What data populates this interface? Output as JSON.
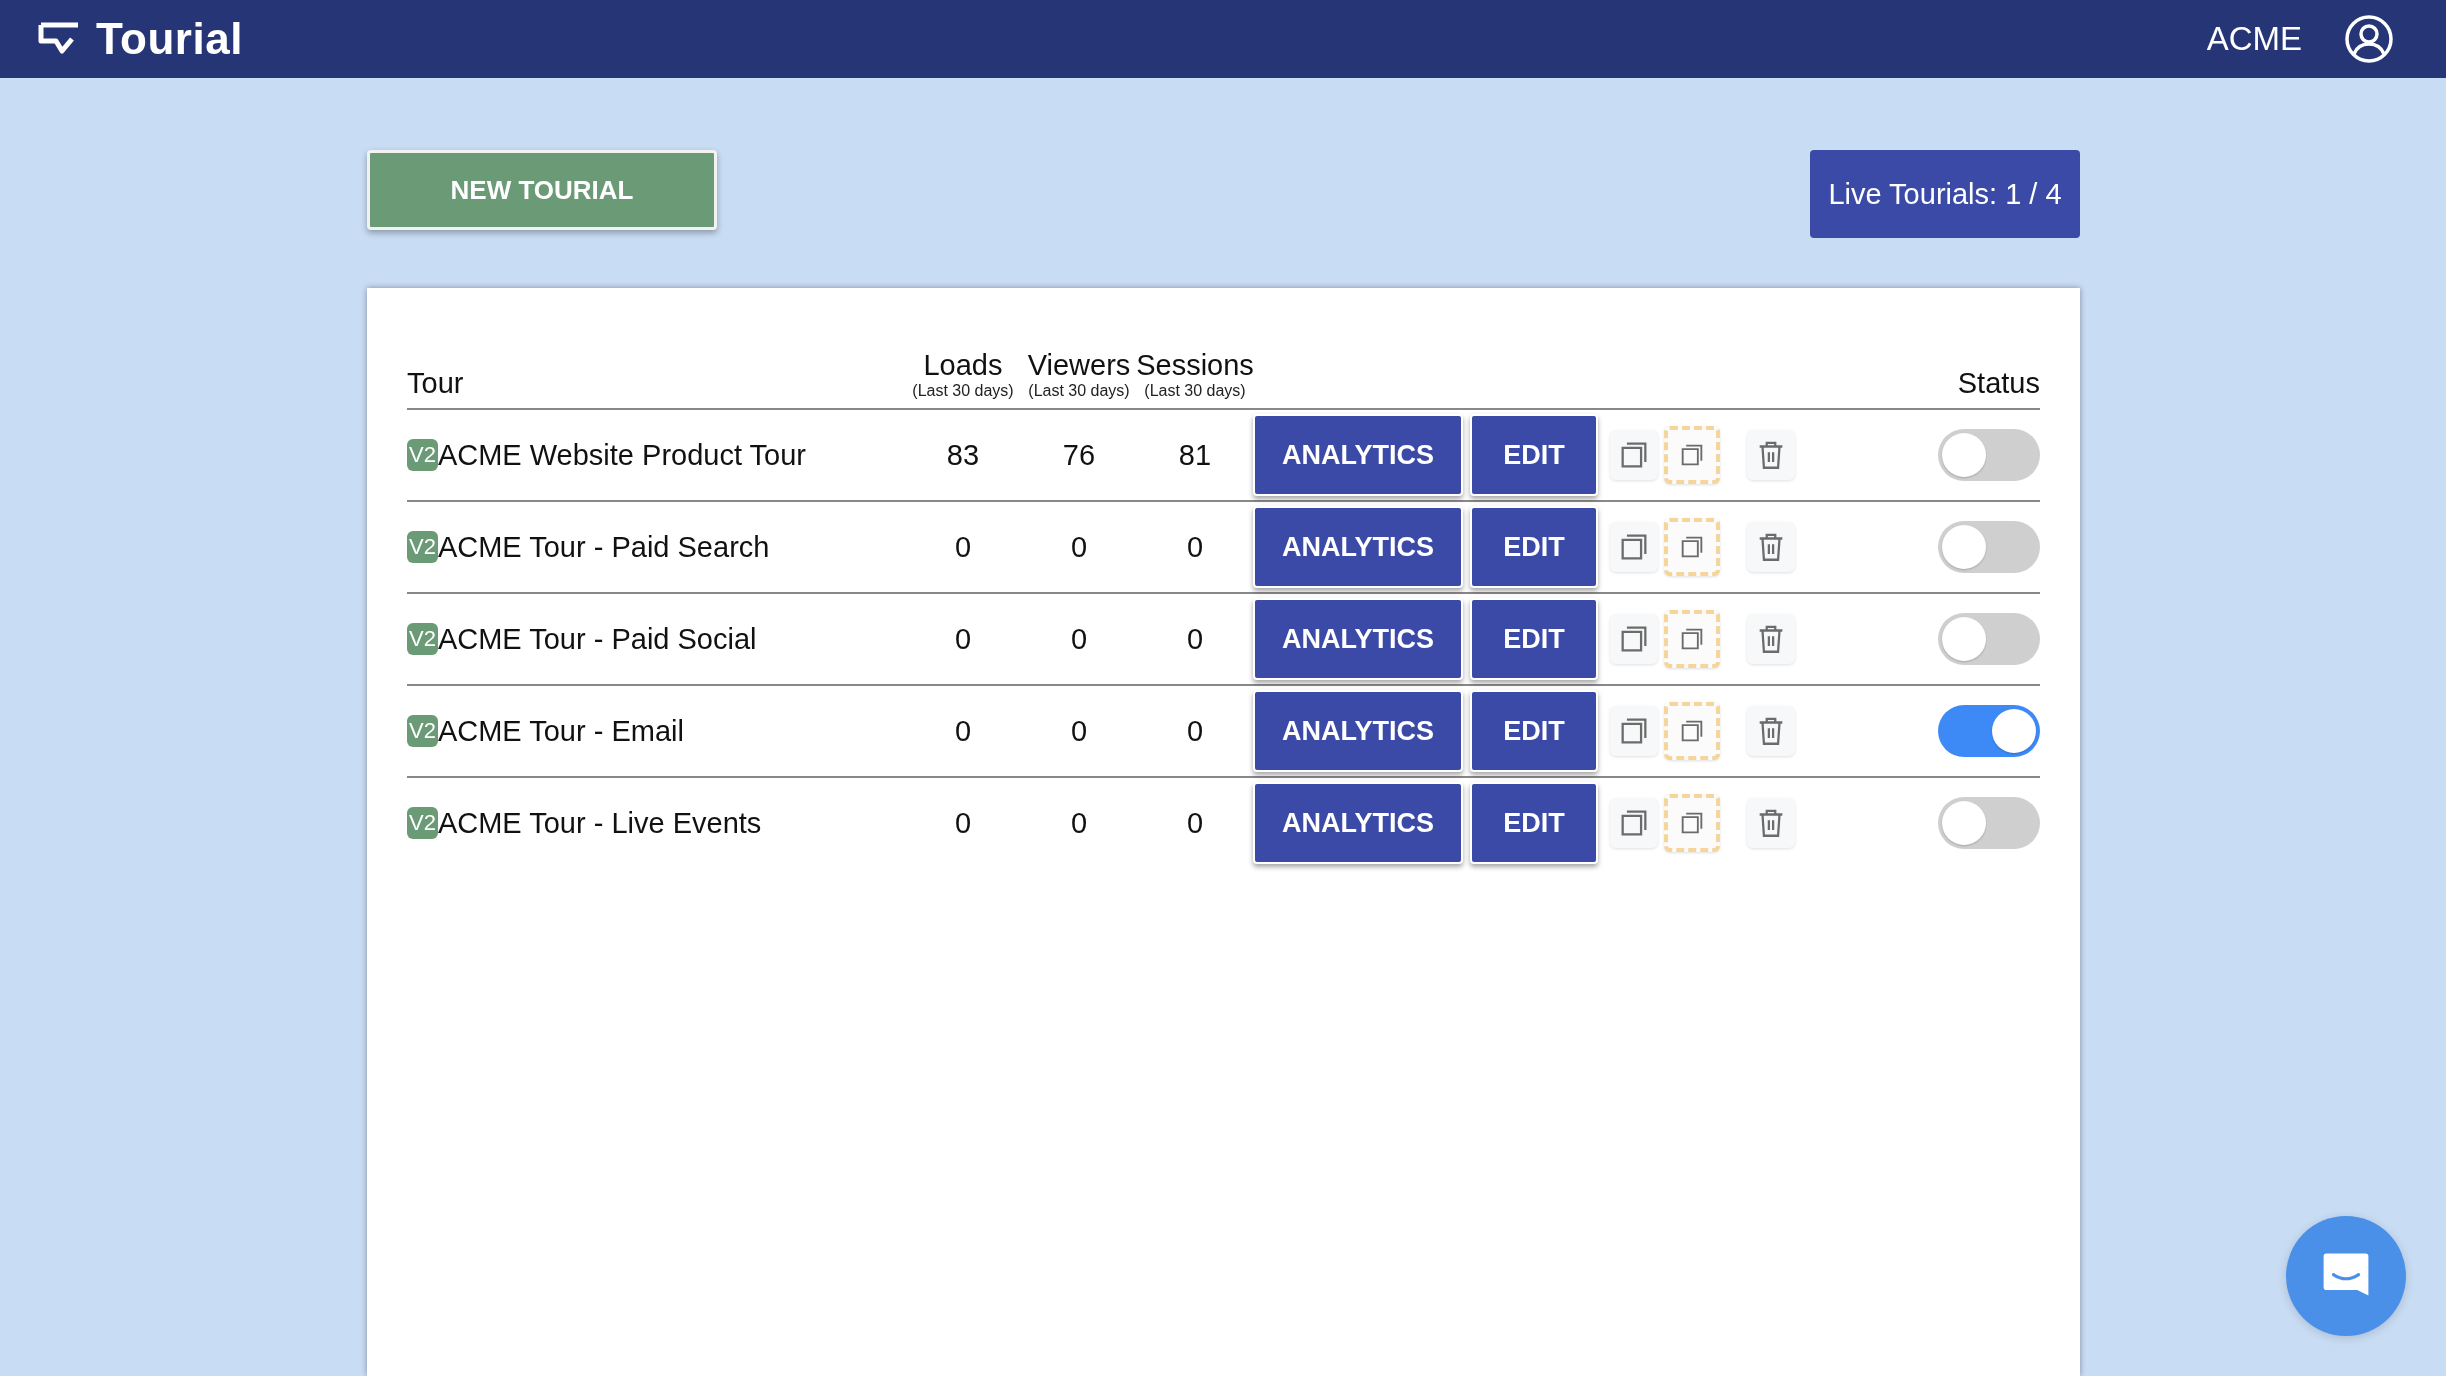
{
  "header": {
    "logo": "Tourial",
    "account": "ACME"
  },
  "new_button": "NEW TOURIAL",
  "live_count": "Live Tourials: 1 / 4",
  "table": {
    "columns": [
      {
        "label": "Tour"
      },
      {
        "label": "Loads",
        "sublabel": "(Last 30 days)"
      },
      {
        "label": "Viewers",
        "sublabel": "(Last 30 days)"
      },
      {
        "label": "Sessions",
        "sublabel": "(Last 30 days)"
      },
      {
        "label": "Status"
      }
    ],
    "rows": [
      {
        "badge": "V2",
        "name": "ACME Website Product Tour",
        "loads": "83",
        "viewers": "76",
        "sessions": "81",
        "analytics": "ANALYTICS",
        "edit": "EDIT",
        "on": false
      },
      {
        "badge": "V2",
        "name": "ACME Tour - Paid Search",
        "loads": "0",
        "viewers": "0",
        "sessions": "0",
        "analytics": "ANALYTICS",
        "edit": "EDIT",
        "on": false
      },
      {
        "badge": "V2",
        "name": "ACME Tour - Paid Social",
        "loads": "0",
        "viewers": "0",
        "sessions": "0",
        "analytics": "ANALYTICS",
        "edit": "EDIT",
        "on": false
      },
      {
        "badge": "V2",
        "name": "ACME Tour - Email",
        "loads": "0",
        "viewers": "0",
        "sessions": "0",
        "analytics": "ANALYTICS",
        "edit": "EDIT",
        "on": true
      },
      {
        "badge": "V2",
        "name": "ACME Tour - Live Events",
        "loads": "0",
        "viewers": "0",
        "sessions": "0",
        "analytics": "ANALYTICS",
        "edit": "EDIT",
        "on": false
      }
    ]
  }
}
